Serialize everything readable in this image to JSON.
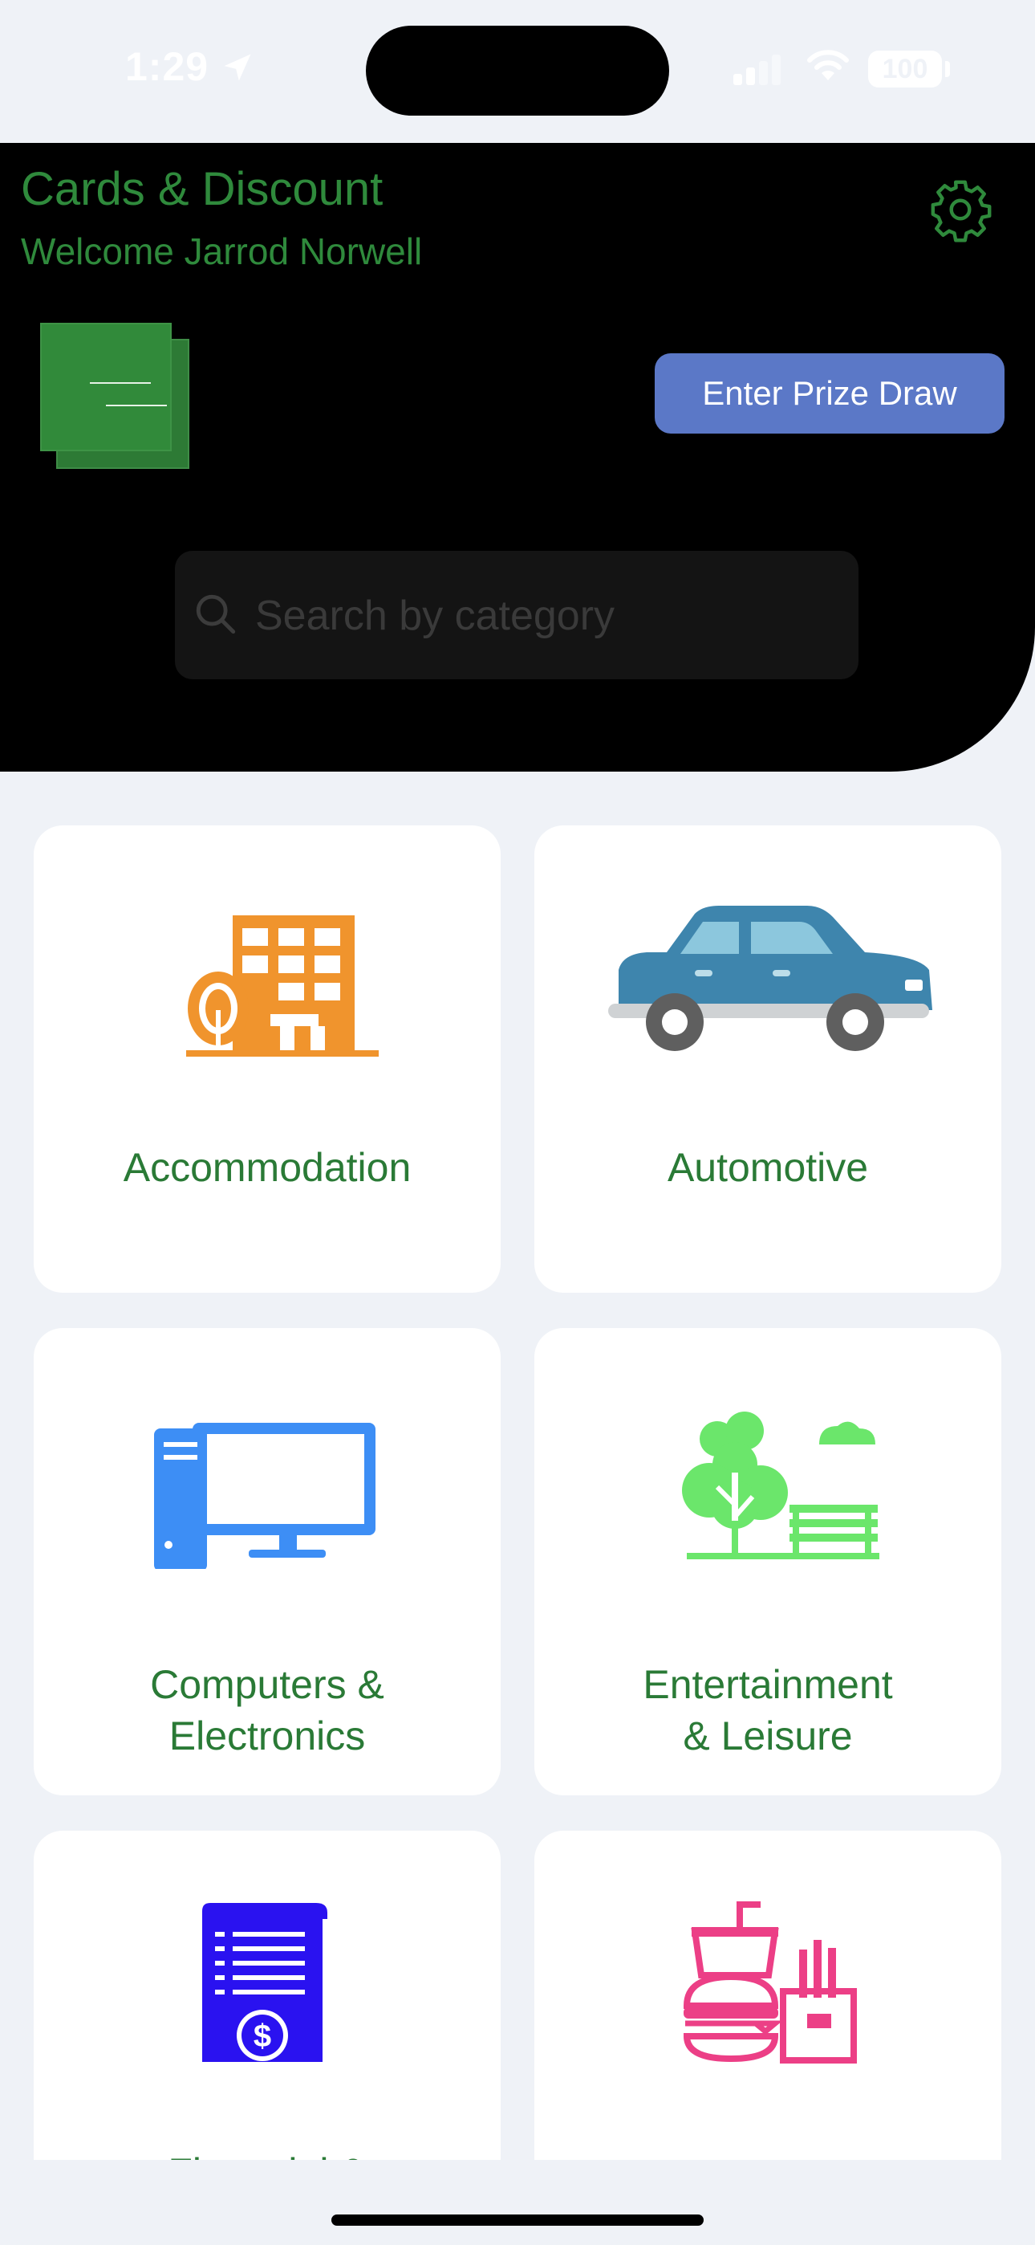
{
  "status_bar": {
    "time": "1:29",
    "battery": "100"
  },
  "header": {
    "title": "Cards & Discount",
    "welcome": "Welcome Jarrod Norwell",
    "prize_button": "Enter Prize Draw"
  },
  "search": {
    "placeholder": "Search by category"
  },
  "categories": [
    {
      "label1": "Accommodation",
      "label2": "",
      "icon": "building-tree-icon",
      "color": "#f0942d"
    },
    {
      "label1": "Automotive",
      "label2": "",
      "icon": "car-icon",
      "color": "#3e85ad"
    },
    {
      "label1": "Computers &",
      "label2": "Electronics",
      "icon": "desktop-computer-icon",
      "color": "#3d8ef5"
    },
    {
      "label1": "Entertainment",
      "label2": "& Leisure",
      "icon": "park-tree-bench-icon",
      "color": "#6be66b"
    },
    {
      "label1": "Financial &",
      "label2": "",
      "icon": "invoice-dollar-icon",
      "color": "#2a12f0"
    },
    {
      "label1": "",
      "label2": "",
      "icon": "fast-food-icon",
      "color": "#ec3f86"
    }
  ]
}
